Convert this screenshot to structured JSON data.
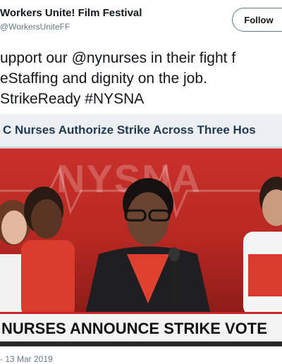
{
  "author": {
    "name": "Workers Unite! Film Festival",
    "handle": "@WorkersUniteFF"
  },
  "follow_label": "Follow",
  "tweet": {
    "lines": [
      "upport our @nynurses in their fight f",
      "eStaffing and dignity on the job.",
      "StrikeReady #NYSNA"
    ]
  },
  "media": {
    "headline": "C Nurses Authorize Strike Across Three Hos",
    "lower_third": "NURSES ANNOUNCE STRIKE VOTE",
    "accent_color": "#c6262a"
  },
  "timestamp": "- 13 Mar 2019"
}
